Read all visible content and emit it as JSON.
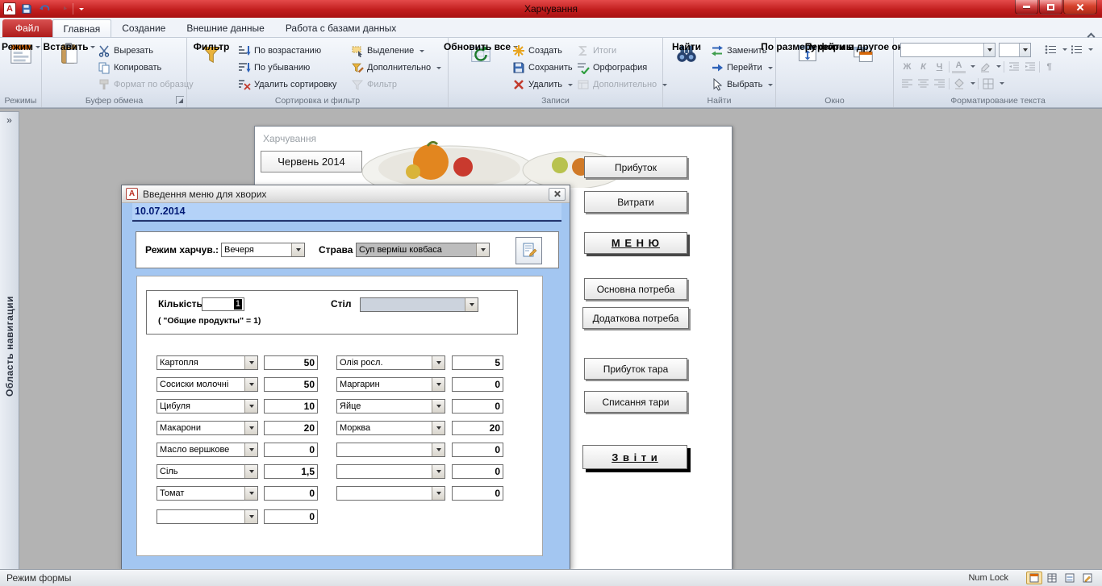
{
  "app": {
    "icon_letter": "A"
  },
  "window": {
    "title": "Харчування"
  },
  "tabs": {
    "file": "Файл",
    "items": [
      "Главная",
      "Создание",
      "Внешние данные",
      "Работа с базами данных"
    ]
  },
  "ribbon": {
    "views": {
      "label": "Режимы",
      "view_button": "Режим"
    },
    "clipboard": {
      "label": "Буфер обмена",
      "paste": "Вставить",
      "cut": "Вырезать",
      "copy": "Копировать",
      "format_painter": "Формат по образцу"
    },
    "sort_filter": {
      "label": "Сортировка и фильтр",
      "filter_big": "Фильтр",
      "sort_asc": "По возрастанию",
      "sort_desc": "По убыванию",
      "clear_sorts": "Удалить сортировку",
      "selection": "Выделение",
      "advanced": "Дополнительно",
      "toggle_filter": "Фильтр"
    },
    "records": {
      "label": "Записи",
      "refresh_all": "Обновить все",
      "new": "Создать",
      "save": "Сохранить",
      "delete": "Удалить",
      "totals": "Итоги",
      "spelling": "Орфография",
      "more": "Дополнительно"
    },
    "find": {
      "label": "Найти",
      "find_big": "Найти",
      "replace": "Заменить",
      "goto": "Перейти",
      "select": "Выбрать"
    },
    "window_group": {
      "label": "Окно",
      "size_to_fit": "По размеру формы",
      "switch_windows": "Перейти в другое окно"
    },
    "text_format": {
      "label": "Форматирование текста",
      "bold_glyph": "Ж",
      "italic_glyph": "К",
      "underline_glyph": "Ч",
      "font_color_glyph": "А",
      "para_glyph": "¶"
    }
  },
  "nav_pane": {
    "label": "Область навигации",
    "expand_icon": "»"
  },
  "main_form": {
    "title": "Харчування",
    "month_button": "Червень 2014",
    "buttons": {
      "income": "Прибуток",
      "expenses": "Витрати",
      "menu": "М Е Н Ю",
      "basic_need": "Основна потреба",
      "extra_need": "Додаткова потреба",
      "income_tare": "Прибуток тара",
      "writeoff_tare": "Списання тари",
      "reports": "З в і т и"
    }
  },
  "dialog": {
    "title": "Введення меню для хворих",
    "date": "10.07.2014",
    "meal_label": "Режим харчув.:",
    "meal_value": "Вечеря",
    "dish_label": "Страва",
    "dish_value": "Суп верміш ковбаса",
    "qty_label": "Кількість",
    "qty_value": "1",
    "qty_note": "( \"Общие продукты\" = 1)",
    "table_label": "Стіл",
    "table_value": "",
    "products_left": [
      {
        "name": "Картопля",
        "qty": "50"
      },
      {
        "name": "Сосиски молочні",
        "qty": "50"
      },
      {
        "name": "Цибуля",
        "qty": "10"
      },
      {
        "name": "Макарони",
        "qty": "20"
      },
      {
        "name": "Масло вершкове",
        "qty": "0"
      },
      {
        "name": "Сіль",
        "qty": "1,5"
      },
      {
        "name": "Томат",
        "qty": "0"
      },
      {
        "name": "",
        "qty": "0"
      }
    ],
    "products_right": [
      {
        "name": "Олія росл.",
        "qty": "5"
      },
      {
        "name": "Маргарин",
        "qty": "0"
      },
      {
        "name": "Яйце",
        "qty": "0"
      },
      {
        "name": "Морква",
        "qty": "20"
      },
      {
        "name": "",
        "qty": "0"
      },
      {
        "name": "",
        "qty": "0"
      },
      {
        "name": "",
        "qty": "0"
      }
    ]
  },
  "status_bar": {
    "view_label": "Режим формы",
    "numlock": "Num Lock"
  }
}
